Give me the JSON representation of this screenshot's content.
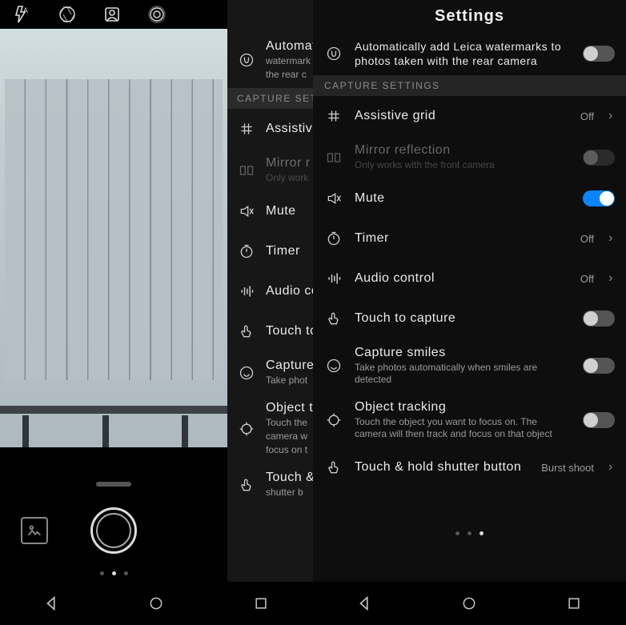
{
  "camera_topbar": {
    "icons": [
      "flash-auto-icon",
      "aperture-icon",
      "portrait-icon",
      "effects-icon"
    ]
  },
  "settings_title": "Settings",
  "section_header": "CAPTURE SETTINGS",
  "value_off": "Off",
  "items": {
    "watermark": {
      "label": "Automatically add Leica watermarks to photos taken with the rear camera",
      "short": "Automatically",
      "toggle": false
    },
    "grid": {
      "label": "Assistive grid",
      "short": "Assistiv",
      "value": "Off"
    },
    "mirror": {
      "label": "Mirror reflection",
      "short": "Mirror r",
      "sub": "Only works with the front camera",
      "sub_short": "Only work"
    },
    "mute": {
      "label": "Mute",
      "toggle": true
    },
    "timer": {
      "label": "Timer",
      "value": "Off"
    },
    "audio": {
      "label": "Audio control",
      "short": "Audio co",
      "value": "Off"
    },
    "touchcap": {
      "label": "Touch to capture",
      "short": "Touch to",
      "toggle": false
    },
    "smiles": {
      "label": "Capture smiles",
      "short": "Capture",
      "sub": "Take photos automatically when smiles are detected",
      "sub_short": "Take phot",
      "toggle": false
    },
    "tracking": {
      "label": "Object tracking",
      "short": "Object t",
      "sub": "Touch the object you want to focus on. The camera will then track and focus on that object",
      "sub_short": "Touch the",
      "toggle": false
    },
    "touchhold": {
      "label": "Touch & hold shutter button",
      "short": "Touch &",
      "sub_short": "shutter b",
      "value": "Burst shoot"
    }
  },
  "burst_label": "Burst shoot"
}
